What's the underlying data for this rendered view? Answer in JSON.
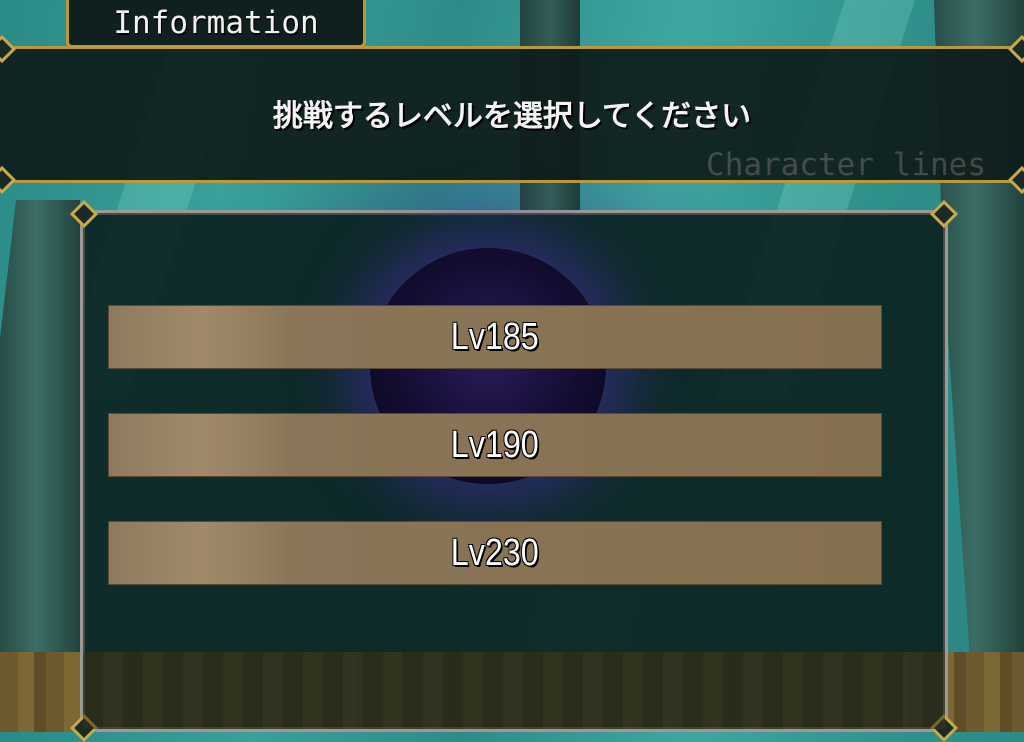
{
  "info_tab": {
    "title": "Information"
  },
  "message": {
    "text": "挑戦するレベルを選択してください",
    "speaker_placeholder": "Character lines"
  },
  "level_options": [
    {
      "label": "Lv185"
    },
    {
      "label": "Lv190"
    },
    {
      "label": "Lv230"
    }
  ],
  "colors": {
    "frame_gold": "#b89a3c",
    "button_tan": "#8e7a5e",
    "panel_dark": "#0a201e"
  }
}
